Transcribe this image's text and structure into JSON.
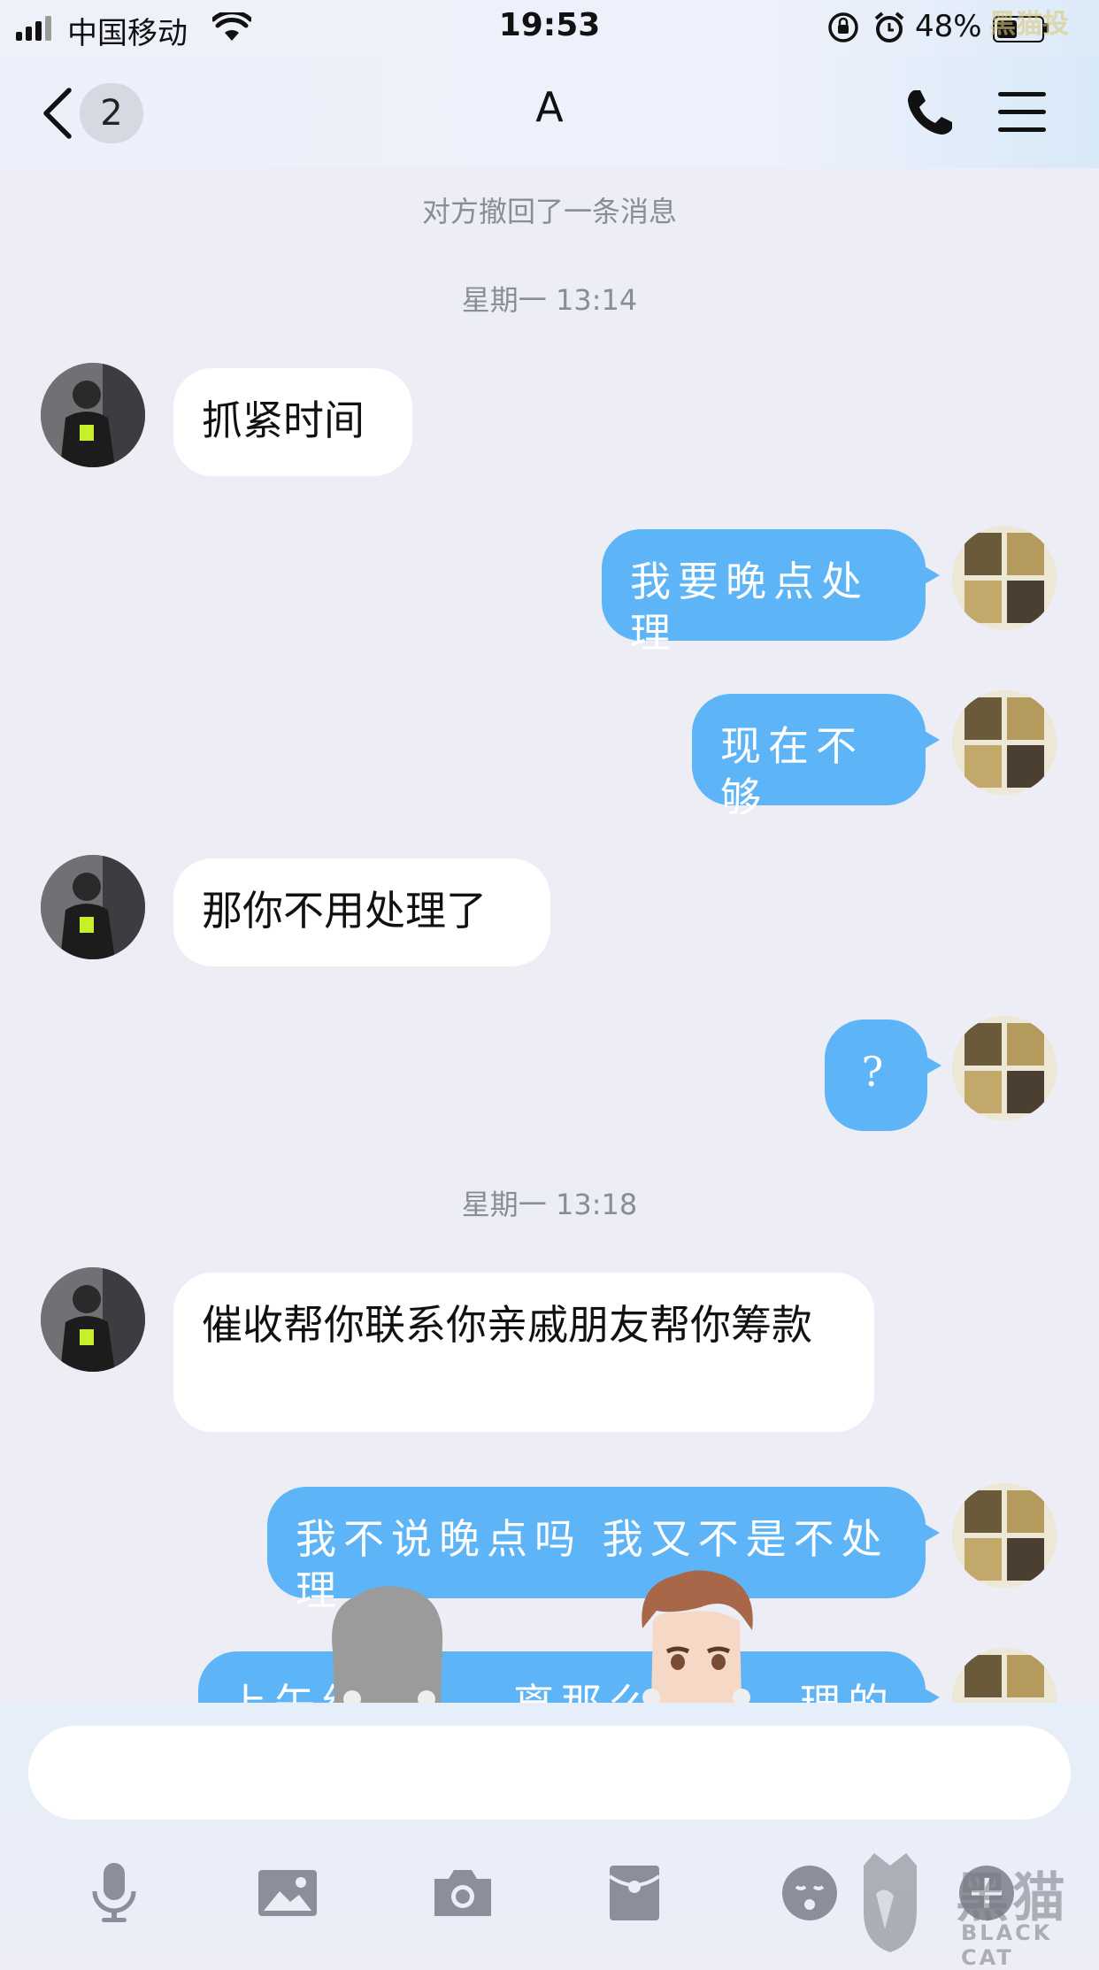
{
  "status_bar": {
    "carrier": "中国移动",
    "time": "19:53",
    "battery_percent_label": "48%",
    "battery_level": 0.48,
    "watermark_top": "黑猫投"
  },
  "nav": {
    "back_icon": "chevron-left-icon",
    "unread_count": "2",
    "title": "A",
    "call_icon": "phone-icon",
    "menu_icon": "hamburger-menu-icon"
  },
  "chat": {
    "system_notice": "对方撤回了一条消息",
    "timestamp_1": "星期一 13:14",
    "timestamp_2": "星期一 13:18",
    "messages": [
      {
        "side": "in",
        "text": "抓紧时间"
      },
      {
        "side": "out",
        "text": "我要晚点处理"
      },
      {
        "side": "out",
        "text": "现在不够"
      },
      {
        "side": "in",
        "text": "那你不用处理了"
      },
      {
        "side": "out",
        "text": "?"
      },
      {
        "side": "in",
        "text": "催收帮你联系你亲戚朋友帮你筹款"
      },
      {
        "side": "out",
        "text": "我不说晚点吗 我又不是不处理"
      },
      {
        "side": "out",
        "text": "上午约　　　离那么久　　理的"
      }
    ]
  },
  "input": {
    "placeholder": ""
  },
  "toolbar": {
    "items": [
      "microphone-icon",
      "image-icon",
      "camera-icon",
      "red-packet-icon",
      "emoji-icon",
      "plus-icon"
    ]
  },
  "watermark": {
    "brand_cn": "黑猫",
    "brand_en": "BLACK CAT"
  },
  "colors": {
    "outgoing_bubble": "#5DB5F7",
    "incoming_bubble": "#FFFFFF",
    "background": "#ECEDF5"
  }
}
